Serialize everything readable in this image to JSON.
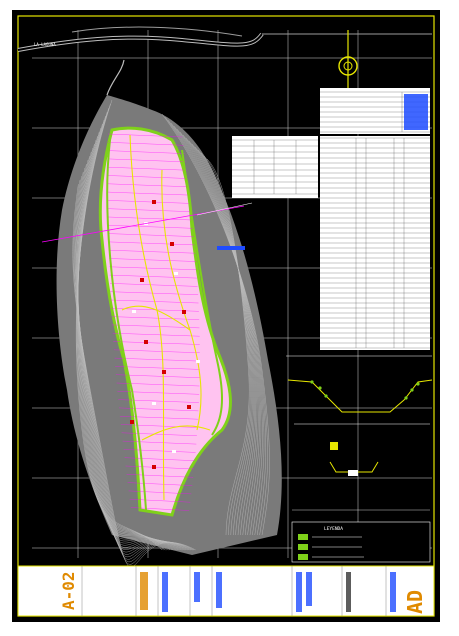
{
  "drawing": {
    "sheet_code": "A-02",
    "background": "#000000",
    "frame_color": "#e6e600",
    "grid_color": "#d8d8d8",
    "contour_color": "#bdbdbd",
    "terrain_color": "#7a7a7a",
    "lot_color": "#7fd11a",
    "road_color": "#ff00ff",
    "lot_fill_color": "#ffc3f0",
    "bullet_color": "#d40000",
    "logo_color": "#e08a00",
    "logo_text": "AD"
  },
  "road_label": "LA LAGUNA",
  "legend_title": "LEYENDA"
}
